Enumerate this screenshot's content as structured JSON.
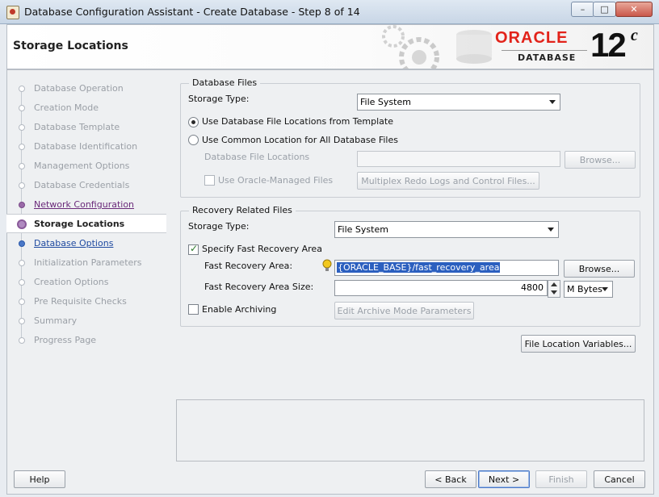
{
  "window": {
    "title": "Database Configuration Assistant - Create Database - Step 8 of 14",
    "controls": {
      "minimize": "–",
      "maximize": "□",
      "close": "✕"
    }
  },
  "header": {
    "title": "Storage Locations",
    "brand": "ORACLE",
    "brand_sub": "DATABASE",
    "version": "12",
    "version_suffix": "c"
  },
  "nav": {
    "steps": [
      {
        "label": "Database Operation",
        "state": "disabled"
      },
      {
        "label": "Creation Mode",
        "state": "disabled"
      },
      {
        "label": "Database Template",
        "state": "disabled"
      },
      {
        "label": "Database Identification",
        "state": "disabled"
      },
      {
        "label": "Management Options",
        "state": "disabled"
      },
      {
        "label": "Database Credentials",
        "state": "disabled"
      },
      {
        "label": "Network Configuration",
        "state": "done"
      },
      {
        "label": "Storage Locations",
        "state": "current"
      },
      {
        "label": "Database Options",
        "state": "next"
      },
      {
        "label": "Initialization Parameters",
        "state": "disabled"
      },
      {
        "label": "Creation Options",
        "state": "disabled"
      },
      {
        "label": "Pre Requisite Checks",
        "state": "disabled"
      },
      {
        "label": "Summary",
        "state": "disabled"
      },
      {
        "label": "Progress Page",
        "state": "disabled"
      }
    ]
  },
  "db_files": {
    "group_title": "Database Files",
    "storage_type_label": "Storage Type:",
    "storage_type_value": "File System",
    "radio_template_label": "Use Database File Locations from Template",
    "radio_common_label": "Use Common Location for All Database Files",
    "file_locations_label": "Database File Locations",
    "file_locations_value": "",
    "browse_label": "Browse...",
    "omf_label": "Use Oracle-Managed Files",
    "multiplex_label": "Multiplex Redo Logs and Control Files..."
  },
  "recovery": {
    "group_title": "Recovery Related Files",
    "storage_type_label": "Storage Type:",
    "storage_type_value": "File System",
    "fra_check_label": "Specify Fast Recovery Area",
    "fra_label": "Fast Recovery Area:",
    "fra_value": "{ORACLE_BASE}/fast_recovery_area",
    "browse_label": "Browse...",
    "size_label": "Fast Recovery Area Size:",
    "size_value": "4800",
    "size_unit": "M Bytes",
    "archiving_label": "Enable Archiving",
    "archive_params_label": "Edit Archive Mode Parameters"
  },
  "file_location_variables_label": "File Location Variables...",
  "footer": {
    "help": "Help",
    "back": "< Back",
    "next": "Next >",
    "finish": "Finish",
    "cancel": "Cancel"
  }
}
